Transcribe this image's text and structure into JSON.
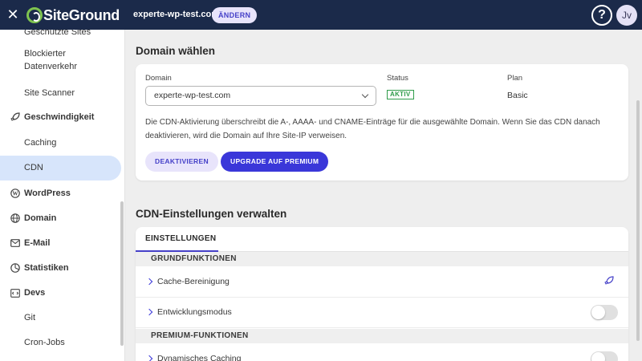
{
  "header": {
    "logo_text": "SiteGround",
    "site_name": "experte-wp-test.com",
    "change_label": "ÄNDERN",
    "help_label": "?",
    "avatar_initials": "Jv",
    "bg_color": "#1b2a4a"
  },
  "sidebar": {
    "items": [
      {
        "label": "Geschützte Sites",
        "icon": ""
      },
      {
        "label": "Blockierter Datenverkehr",
        "icon": ""
      },
      {
        "label": "Site Scanner",
        "icon": ""
      },
      {
        "label": "Geschwindigkeit",
        "icon": "rocket-icon"
      },
      {
        "label": "Caching",
        "icon": ""
      },
      {
        "label": "CDN",
        "icon": "",
        "active": true
      },
      {
        "label": "WordPress",
        "icon": "wordpress-icon"
      },
      {
        "label": "Domain",
        "icon": "globe-icon"
      },
      {
        "label": "E-Mail",
        "icon": "mail-icon"
      },
      {
        "label": "Statistiken",
        "icon": "pie-chart-icon"
      },
      {
        "label": "Devs",
        "icon": "code-icon"
      },
      {
        "label": "Git",
        "icon": ""
      },
      {
        "label": "Cron-Jobs",
        "icon": ""
      }
    ]
  },
  "domain_section": {
    "title": "Domain wählen",
    "domain_label": "Domain",
    "domain_value": "experte-wp-test.com",
    "status_label": "Status",
    "status_value": "AKTIV",
    "plan_label": "Plan",
    "plan_value": "Basic",
    "description": "Die CDN-Aktivierung überschreibt die A-, AAAA- und CNAME-Einträge für die ausgewählte Domain. Wenn Sie das CDN danach deaktivieren, wird die Domain auf Ihre Site-IP verweisen.",
    "deactivate_label": "DEAKTIVIEREN",
    "upgrade_label": "UPGRADE AUF PREMIUM"
  },
  "cdn_settings": {
    "title": "CDN-Einstellungen verwalten",
    "tab_label": "EINSTELLUNGEN",
    "basic_header": "GRUNDFUNKTIONEN",
    "premium_header": "PREMIUM-FUNKTIONEN",
    "rows": {
      "cache_purge": "Cache-Bereinigung",
      "dev_mode": "Entwicklungsmodus",
      "dynamic_caching": "Dynamisches Caching"
    },
    "toggles": {
      "dev_mode": false,
      "dynamic_caching": false
    }
  },
  "colors": {
    "accent": "#3a37d9",
    "status_green": "#2f9c4a",
    "active_nav": "#d7e5fb"
  }
}
